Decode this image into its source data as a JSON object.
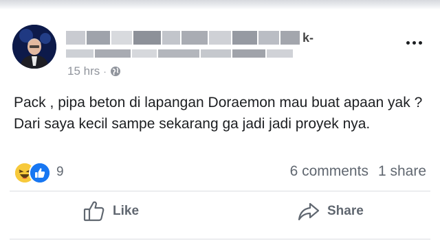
{
  "post": {
    "author_suffix": "k-",
    "timestamp": "15 hrs",
    "separator": "·",
    "text": "Pack , pipa beton di lapangan Doraemon mau buat apaan yak ? Dari saya kecil sampe sekarang ga jadi jadi proyek nya.",
    "reactions": {
      "count": "9",
      "icons": [
        "haha-icon",
        "like-icon"
      ]
    },
    "comments": "6 comments",
    "shares": "1 share"
  },
  "actions": {
    "like_label": "Like",
    "share_label": "Share"
  },
  "colors": {
    "like_blue": "#1877f2",
    "haha_yellow": "#f7c93b",
    "meta_gray": "#606770",
    "timestamp_gray": "#90949c"
  }
}
